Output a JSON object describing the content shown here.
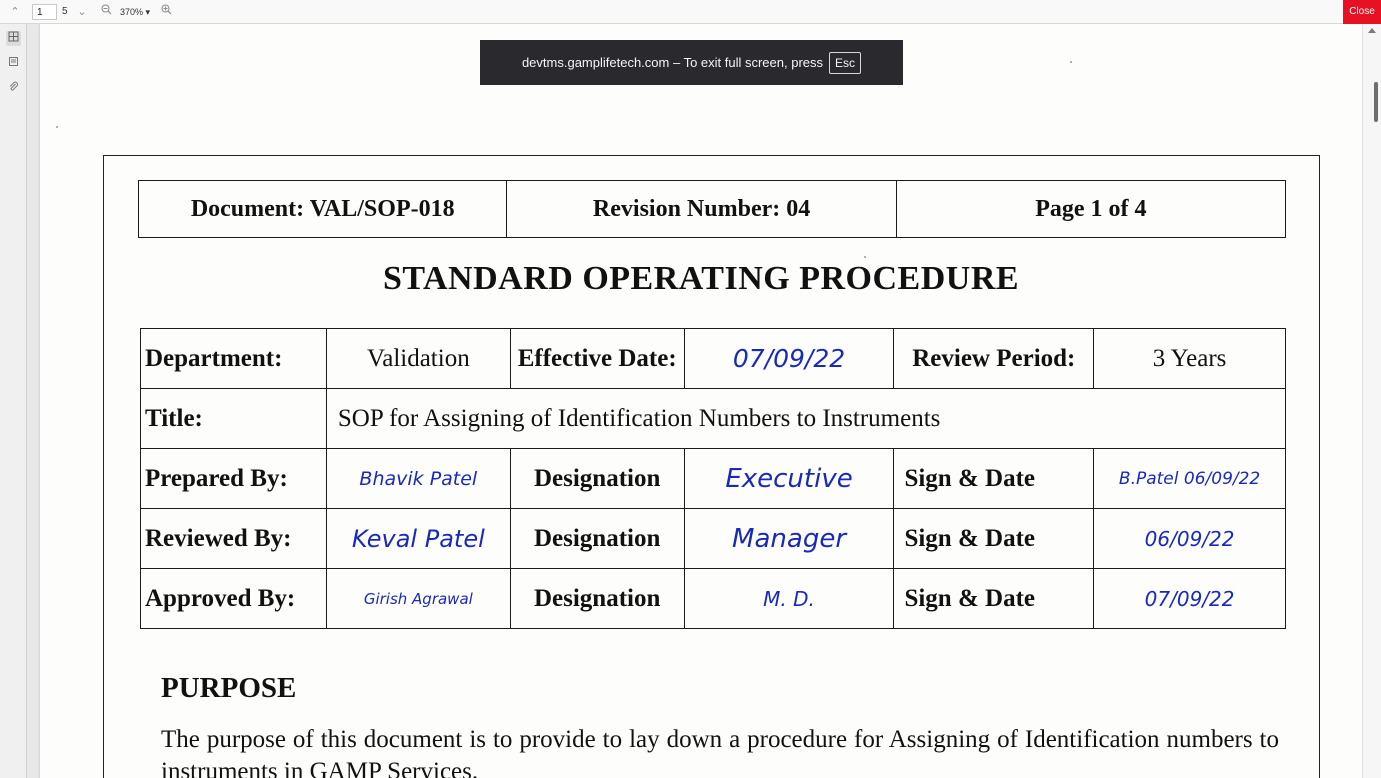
{
  "toolbar": {
    "current_page": "1",
    "total_pages": "5",
    "zoom": "370%",
    "close_label": "Close"
  },
  "fullscreen_notice": {
    "message": "devtms.gamplifetech.com – To exit full screen, press",
    "key": "Esc"
  },
  "document": {
    "header": {
      "document": "Document: VAL/SOP-018",
      "revision": "Revision Number: 04",
      "page": "Page 1 of 4"
    },
    "title": "STANDARD OPERATING PROCEDURE",
    "info": {
      "department_label": "Department:",
      "department_value": "Validation",
      "effective_label": "Effective Date:",
      "effective_value": "07/09/22",
      "review_label": "Review Period:",
      "review_value": "3 Years",
      "title_label": "Title:",
      "title_value": "SOP for Assigning of Identification Numbers to Instruments"
    },
    "approvals": [
      {
        "role": "Prepared By:",
        "name": "Bhavik Patel",
        "designation_label": "Designation",
        "designation": "Executive",
        "sign_label": "Sign & Date",
        "sign": "B.Patel 06/09/22"
      },
      {
        "role": "Reviewed By:",
        "name": "Keval Patel",
        "designation_label": "Designation",
        "designation": "Manager",
        "sign_label": "Sign & Date",
        "sign": "06/09/22"
      },
      {
        "role": "Approved By:",
        "name": "Girish Agrawal",
        "designation_label": "Designation",
        "designation": "M. D.",
        "sign_label": "Sign & Date",
        "sign": "07/09/22"
      }
    ],
    "section_heading": "PURPOSE",
    "purpose_text": "The purpose of this document is to provide to lay down a procedure for Assigning of Identification numbers to instruments in GAMP Services."
  },
  "colors": {
    "close": "#e81123",
    "ink": "#1a2ab8",
    "notice_bg": "#2a2a2e"
  },
  "icons": {
    "prev": "chevron-up-icon",
    "next": "chevron-down-icon",
    "zoom_out": "zoom-out-icon",
    "zoom_in": "zoom-in-icon",
    "thumbnails": "thumbnails-icon",
    "outline": "outline-icon",
    "attachments": "paperclip-icon"
  }
}
